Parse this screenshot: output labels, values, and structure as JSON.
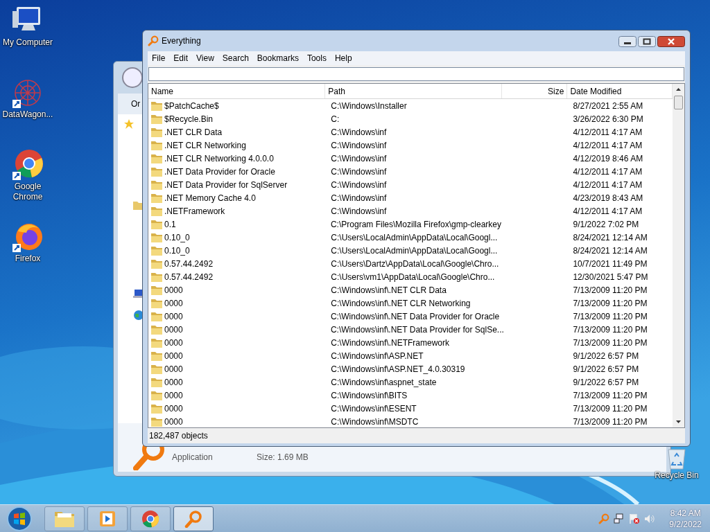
{
  "desktop_icons": [
    {
      "label": "My Computer",
      "kind": "computer"
    },
    {
      "label": "DataWagon...",
      "kind": "datawagon"
    },
    {
      "label": "Google Chrome",
      "kind": "chrome"
    },
    {
      "label": "Firefox",
      "kind": "firefox"
    }
  ],
  "recycle_bin": {
    "label": "Recycle Bin"
  },
  "back_window": {
    "toolbar_button": "Or",
    "file_type": "Application",
    "file_size": "Size: 1.69 MB"
  },
  "window": {
    "title": "Everything",
    "menu": [
      "File",
      "Edit",
      "View",
      "Search",
      "Bookmarks",
      "Tools",
      "Help"
    ],
    "table": {
      "columns": [
        "Name",
        "Path",
        "Size",
        "Date Modified"
      ],
      "rows": [
        {
          "name": "$PatchCache$",
          "path": "C:\\Windows\\Installer",
          "date": "8/27/2021 2:55 AM"
        },
        {
          "name": "$Recycle.Bin",
          "path": "C:",
          "date": "3/26/2022 6:30 PM"
        },
        {
          "name": ".NET CLR Data",
          "path": "C:\\Windows\\inf",
          "date": "4/12/2011 4:17 AM"
        },
        {
          "name": ".NET CLR Networking",
          "path": "C:\\Windows\\inf",
          "date": "4/12/2011 4:17 AM"
        },
        {
          "name": ".NET CLR Networking 4.0.0.0",
          "path": "C:\\Windows\\inf",
          "date": "4/12/2019 8:46 AM"
        },
        {
          "name": ".NET Data Provider for Oracle",
          "path": "C:\\Windows\\inf",
          "date": "4/12/2011 4:17 AM"
        },
        {
          "name": ".NET Data Provider for SqlServer",
          "path": "C:\\Windows\\inf",
          "date": "4/12/2011 4:17 AM"
        },
        {
          "name": ".NET Memory Cache 4.0",
          "path": "C:\\Windows\\inf",
          "date": "4/23/2019 8:43 AM"
        },
        {
          "name": ".NETFramework",
          "path": "C:\\Windows\\inf",
          "date": "4/12/2011 4:17 AM"
        },
        {
          "name": "0.1",
          "path": "C:\\Program Files\\Mozilla Firefox\\gmp-clearkey",
          "date": "9/1/2022 7:02 PM"
        },
        {
          "name": "0.10_0",
          "path": "C:\\Users\\LocalAdmin\\AppData\\Local\\Googl...",
          "date": "8/24/2021 12:14 AM"
        },
        {
          "name": "0.10_0",
          "path": "C:\\Users\\LocalAdmin\\AppData\\Local\\Googl...",
          "date": "8/24/2021 12:14 AM"
        },
        {
          "name": "0.57.44.2492",
          "path": "C:\\Users\\Dartz\\AppData\\Local\\Google\\Chro...",
          "date": "10/7/2021 11:49 PM"
        },
        {
          "name": "0.57.44.2492",
          "path": "C:\\Users\\vm1\\AppData\\Local\\Google\\Chro...",
          "date": "12/30/2021 5:47 PM"
        },
        {
          "name": "0000",
          "path": "C:\\Windows\\inf\\.NET CLR Data",
          "date": "7/13/2009 11:20 PM"
        },
        {
          "name": "0000",
          "path": "C:\\Windows\\inf\\.NET CLR Networking",
          "date": "7/13/2009 11:20 PM"
        },
        {
          "name": "0000",
          "path": "C:\\Windows\\inf\\.NET Data Provider for Oracle",
          "date": "7/13/2009 11:20 PM"
        },
        {
          "name": "0000",
          "path": "C:\\Windows\\inf\\.NET Data Provider for SqlSe...",
          "date": "7/13/2009 11:20 PM"
        },
        {
          "name": "0000",
          "path": "C:\\Windows\\inf\\.NETFramework",
          "date": "7/13/2009 11:20 PM"
        },
        {
          "name": "0000",
          "path": "C:\\Windows\\inf\\ASP.NET",
          "date": "9/1/2022 6:57 PM"
        },
        {
          "name": "0000",
          "path": "C:\\Windows\\inf\\ASP.NET_4.0.30319",
          "date": "9/1/2022 6:57 PM"
        },
        {
          "name": "0000",
          "path": "C:\\Windows\\inf\\aspnet_state",
          "date": "9/1/2022 6:57 PM"
        },
        {
          "name": "0000",
          "path": "C:\\Windows\\inf\\BITS",
          "date": "7/13/2009 11:20 PM"
        },
        {
          "name": "0000",
          "path": "C:\\Windows\\inf\\ESENT",
          "date": "7/13/2009 11:20 PM"
        },
        {
          "name": "0000",
          "path": "C:\\Windows\\inf\\MSDTC",
          "date": "7/13/2009 11:20 PM"
        }
      ]
    },
    "status_bar": "182,487 objects"
  },
  "taskbar": {
    "buttons": [
      {
        "kind": "explorer",
        "selected": false
      },
      {
        "kind": "media",
        "selected": false
      },
      {
        "kind": "chrome",
        "selected": false
      },
      {
        "kind": "everything",
        "selected": true
      }
    ],
    "clock": {
      "time": "8:42 AM",
      "date": "9/2/2022"
    }
  }
}
